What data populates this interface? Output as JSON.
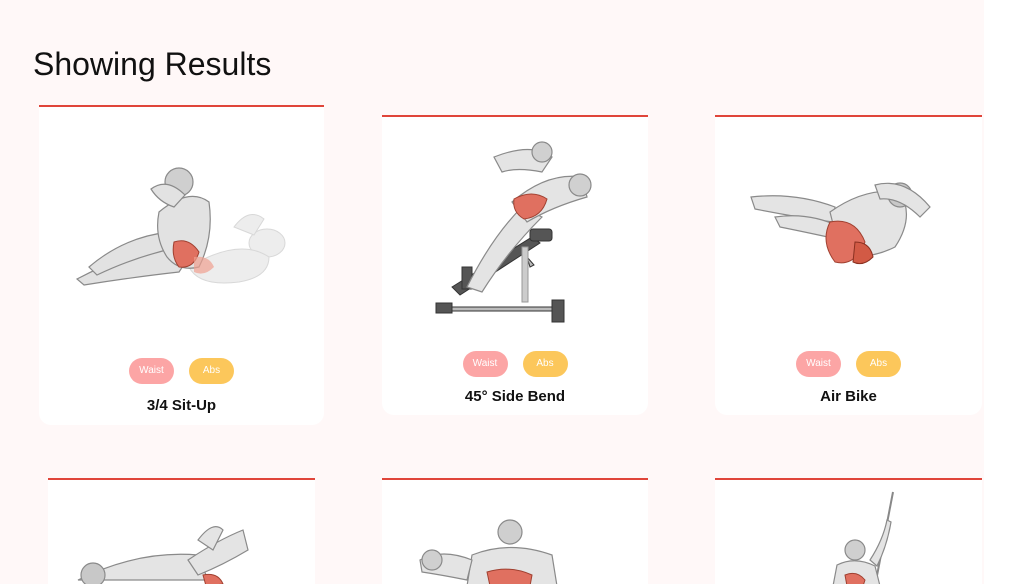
{
  "header": {
    "title": "Showing Results"
  },
  "cards": [
    {
      "name": "3/4 Sit-Up",
      "tags": [
        "Waist",
        "Abs"
      ],
      "image": "sit-up-figure"
    },
    {
      "name": "45° Side Bend",
      "tags": [
        "Waist",
        "Abs"
      ],
      "image": "side-bend-figure"
    },
    {
      "name": "Air Bike",
      "tags": [
        "Waist",
        "Abs"
      ],
      "image": "air-bike-figure"
    },
    {
      "name": "",
      "tags": [],
      "image": "lying-stretch-figure"
    },
    {
      "name": "",
      "tags": [],
      "image": "crunch-figure"
    },
    {
      "name": "",
      "tags": [],
      "image": "cable-figure"
    }
  ],
  "colors": {
    "accent": "#e0453a",
    "waist_tag": "#fca5a5",
    "abs_tag": "#fcc75b",
    "background": "#fff8f8"
  }
}
